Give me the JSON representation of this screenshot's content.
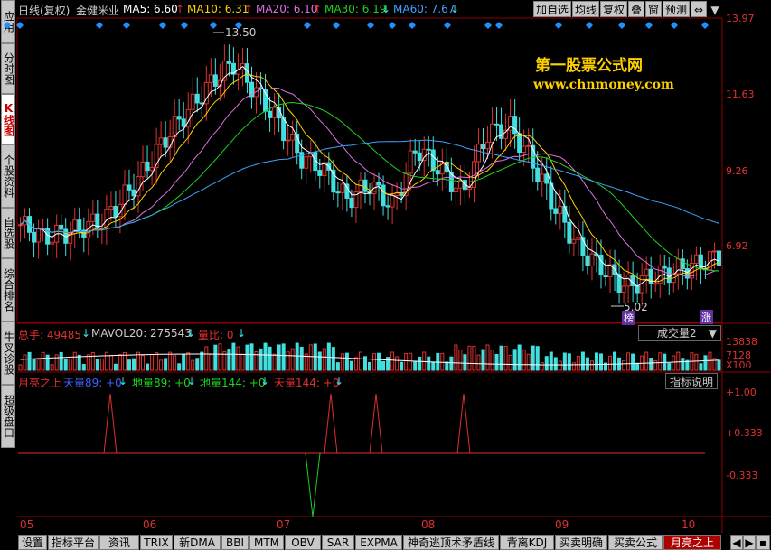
{
  "nav_left": [
    {
      "label": "应用"
    },
    {
      "label": "分时图"
    },
    {
      "label": "K线图"
    },
    {
      "label": "个股资料"
    },
    {
      "label": "自选股"
    },
    {
      "label": "综合排名"
    },
    {
      "label": "牛叉诊股"
    },
    {
      "label": "超级盘口"
    }
  ],
  "header": {
    "period": "日线(复权)",
    "stock_name": "金健米业",
    "ma5": "MA5: 6.60",
    "ma10": "MA10: 6.31",
    "ma20": "MA20: 6.10",
    "ma30": "MA30: 6.19",
    "ma60": "MA60: 7.67",
    "arrow_up": "↑",
    "arrow_down": "↓",
    "buttons": [
      "加自选",
      "均线",
      "复权",
      "叠",
      "窗",
      "预测"
    ],
    "icon_names": [
      "arrow-left-right-icon",
      "dropdown-arrow-icon"
    ]
  },
  "price_scale": [
    "13.97",
    "11.63",
    "9.26",
    "6.92"
  ],
  "annotations": {
    "high": "13.50",
    "low": "5.02",
    "badge_bang": "榜",
    "badge_zhang": "涨"
  },
  "watermark": {
    "line1": "第一股票公式网",
    "line2": "www.chnmoney.com"
  },
  "volume_panel": {
    "total": "总手: 49485",
    "mavol": "MAVOL20: 275543",
    "ratio": "量比: 0",
    "selector": "成交量2",
    "scale": [
      "13838",
      "7128"
    ],
    "unit": "X100"
  },
  "indicator_panel": {
    "title": "月亮之上",
    "sky89": "天量89: +0",
    "ground89": "地量89: +0",
    "ground144": "地量144: +0",
    "sky144": "天量144: +0",
    "button": "指标说明",
    "scale": [
      "+1.00",
      "+0.333",
      "-0.333"
    ]
  },
  "date_labels": [
    "05",
    "06",
    "07",
    "08",
    "09",
    "10"
  ],
  "bottom_tabs": [
    "设置",
    "指标平台",
    "资讯",
    "TRIX",
    "新DMA",
    "BBI",
    "MTM",
    "OBV",
    "SAR",
    "EXPMA",
    "神奇逃顶术矛盾线",
    "背离KDJ",
    "买卖明确",
    "买卖公式",
    "月亮之上"
  ],
  "colors": {
    "up": "#e03030",
    "down": "#40e0e0",
    "ma5": "#ffffff",
    "ma10": "#ffd000",
    "ma20": "#e070e0",
    "ma30": "#20d020",
    "ma60": "#40a0ff"
  }
}
